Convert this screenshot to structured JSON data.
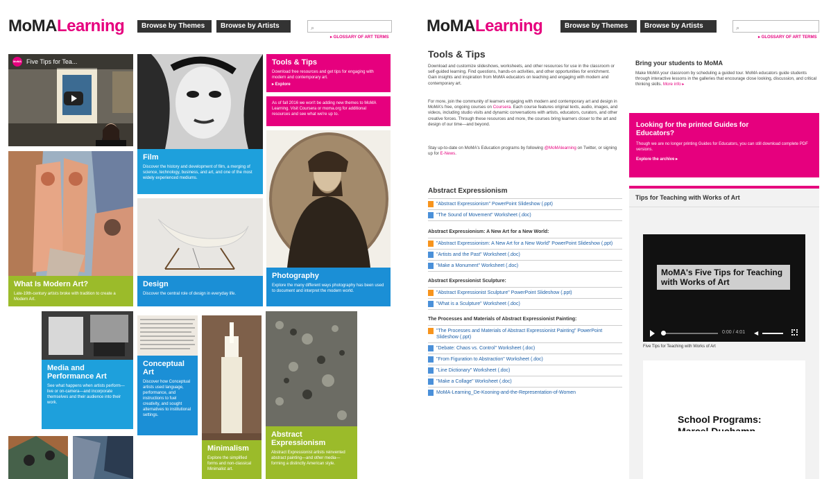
{
  "left": {
    "logo": {
      "moma": "MoMA",
      "learning": "Learning"
    },
    "nav": {
      "themes": "Browse by Themes",
      "artists": "Browse by Artists"
    },
    "search_placeholder": "⌕",
    "glossary": "▸ GLOSSARY OF ART TERMS",
    "video": {
      "badge": "MoMA",
      "title": "Five Tips for Tea..."
    },
    "tiles": {
      "tools": {
        "title": "Tools & Tips",
        "text": "Download free resources and get tips for engaging with modern and contemporary art.",
        "link": "▸ Explore"
      },
      "notice": {
        "text": "As of fall 2016 we won't be adding new themes to MoMA Learning. Visit Coursera or moma.org for additional resources and see what we're up to."
      },
      "film": {
        "title": "Film",
        "text": "Discover the history and development of film, a merging of science, technology, business, and art, and one of the most widely experienced mediums."
      },
      "modern": {
        "title": "What Is Modern Art?",
        "text": "Late-19th-century artists broke with tradition to create a Modern Art."
      },
      "design": {
        "title": "Design",
        "text": "Discover the central role of design in everyday life."
      },
      "photography": {
        "title": "Photography",
        "text": "Explore the many different ways photography has been used to document and interpret the modern world."
      },
      "media": {
        "title": "Media and Performance Art",
        "text": "See what happens when artists perform—live or on-camera—and incorporate themselves and their audience into their work."
      },
      "conceptual": {
        "title": "Conceptual Art",
        "text": "Discover how Conceptual artists used language, performance, and instructions to fuel creativity, and sought alternatives to institutional settings."
      },
      "minimalism": {
        "title": "Minimalism",
        "text": "Explore the simplified forms and non-classical Minimalist art."
      },
      "abstract": {
        "title": "Abstract Expressionism",
        "text": "Abstract Expressionist artists reinvented abstract painting—and other media—forming a distinctly American style."
      }
    }
  },
  "right": {
    "logo": {
      "moma": "MoMA",
      "learning": "Learning"
    },
    "nav": {
      "themes": "Browse by Themes",
      "artists": "Browse by Artists"
    },
    "search_placeholder": "⌕",
    "glossary": "▸ GLOSSARY OF ART TERMS",
    "page_title": "Tools & Tips",
    "intro1": "Download and customize slideshows, worksheets, and other resources for use in the classroom or self-guided learning. Find questions, hands-on activities, and other opportunities for enrichment. Gain insights and inspiration from MoMA educators on teaching and engaging with modern and contemporary art.",
    "intro2_pre": "For more, join the community of learners engaging with modern and contemporary art and design in MoMA's free, ongoing courses on ",
    "intro2_link": "Coursera",
    "intro2_post": ". Each course features original texts, audio, images, and videos, including studio visits and dynamic conversations with artists, educators, curators, and other creative forces. Through these resources and more, the courses bring learners closer to the art and design of our time—and beyond.",
    "intro3_pre": "Stay up-to-date on MoMA's Education programs by following ",
    "intro3_link1": "@MoMAlearning",
    "intro3_mid": " on Twitter, or signing up for ",
    "intro3_link2": "E-News",
    "intro3_end": ".",
    "sections": [
      {
        "title": "Abstract Expressionism",
        "items": [
          {
            "type": "ppt",
            "label": "\"Abstract Expressionism\" PowerPoint Slideshow (.ppt)"
          },
          {
            "type": "doc",
            "label": "\"The Sound of Movement\" Worksheet (.doc)"
          }
        ]
      },
      {
        "title": "Abstract Expressionism: A New Art for a New World:",
        "items": [
          {
            "type": "ppt",
            "label": "\"Abstract Expressionism: A New Art for a New World\" PowerPoint Slideshow (.ppt)"
          },
          {
            "type": "doc",
            "label": "\"Artists and the Past\" Worksheet (.doc)"
          },
          {
            "type": "doc",
            "label": "\"Make a Monument\" Worksheet (.doc)"
          }
        ]
      },
      {
        "title": "Abstract Expressionist Sculpture:",
        "items": [
          {
            "type": "ppt",
            "label": "\"Abstract Expressionist Sculpture\" PowerPoint Slideshow (.ppt)"
          },
          {
            "type": "doc",
            "label": "\"What is a Sculpture\" Worksheet (.doc)"
          }
        ]
      },
      {
        "title": "The Processes and Materials of Abstract Expressionist Painting:",
        "items": [
          {
            "type": "ppt",
            "label": "\"The Processes and Materials of Abstract Expressionist Painting\" PowerPoint Slideshow (.ppt)"
          },
          {
            "type": "doc",
            "label": "\"Debate: Chaos vs. Control\" Worksheet (.doc)"
          },
          {
            "type": "doc",
            "label": "\"From Figuration to Abstraction\" Worksheet (.doc)"
          },
          {
            "type": "doc",
            "label": "\"Line Dictionary\" Worksheet (.doc)"
          },
          {
            "type": "doc",
            "label": "\"Make a Collage\" Worksheet (.doc)"
          },
          {
            "type": "doc",
            "label": "MoMA-Learning_De-Kooning-and-the-Representation-of-Women"
          }
        ]
      }
    ],
    "bring": {
      "title": "Bring your students to MoMA",
      "text": "Make MoMA your classroom by scheduling a guided tour. MoMA educators guide students through interactive lessons in the galleries that encourage close looking, discussion, and critical thinking skills.",
      "link": "More info ▸"
    },
    "guides": {
      "title": "Looking for the printed Guides for Educators?",
      "text": "Though we are no longer printing Guides for Educators, you can still download complete PDF versions.",
      "link": "Explore the archive ▸"
    },
    "tips": {
      "title": "Tips for Teaching with Works of Art",
      "video_title": "MoMA's Five Tips for Teaching with Works of Art",
      "time": "0:00 / 4:01",
      "caption": "Five Tips for Teaching with Works of Art"
    },
    "school": {
      "line1": "School Programs:",
      "line2": "Marcel Duchamp"
    }
  },
  "colors": {
    "pink": "#e6007e",
    "blue": "#1b8fd6",
    "green": "#9bbb2a",
    "dark": "#333333"
  }
}
